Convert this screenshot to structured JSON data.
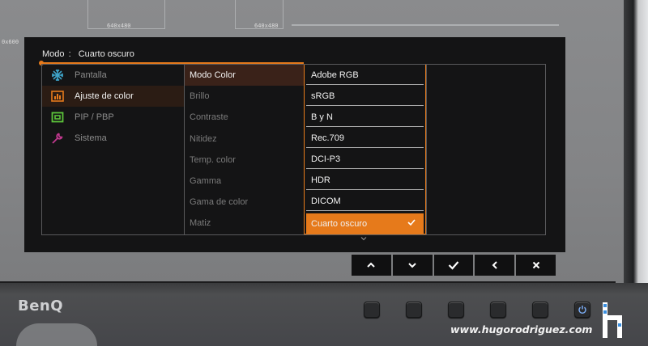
{
  "screen": {
    "guide_labels": [
      "640x480",
      "640x480",
      "0x600"
    ]
  },
  "osd": {
    "mode_label": "Modo",
    "mode_separator": ":",
    "mode_value": "Cuarto oscuro",
    "menu": [
      {
        "label": "Pantalla",
        "icon": "display-icon",
        "color": "#3ea3c8",
        "active": false
      },
      {
        "label": "Ajuste de color",
        "icon": "color-adjust-icon",
        "color": "#e67a1b",
        "active": true
      },
      {
        "label": "PIP / PBP",
        "icon": "pip-icon",
        "color": "#5cc33a",
        "active": false
      },
      {
        "label": "Sistema",
        "icon": "wrench-icon",
        "color": "#c0388e",
        "active": false
      }
    ],
    "submenu": [
      {
        "label": "Modo Color",
        "active": true
      },
      {
        "label": "Brillo",
        "active": false
      },
      {
        "label": "Contraste",
        "active": false
      },
      {
        "label": "Nitidez",
        "active": false
      },
      {
        "label": "Temp. color",
        "active": false
      },
      {
        "label": "Gamma",
        "active": false
      },
      {
        "label": "Gama de color",
        "active": false
      },
      {
        "label": "Matiz",
        "active": false
      }
    ],
    "options": [
      {
        "label": "Adobe RGB",
        "selected": false
      },
      {
        "label": "sRGB",
        "selected": false
      },
      {
        "label": "B y N",
        "selected": false
      },
      {
        "label": "Rec.709",
        "selected": false
      },
      {
        "label": "DCI-P3",
        "selected": false
      },
      {
        "label": "HDR",
        "selected": false
      },
      {
        "label": "DICOM",
        "selected": false
      },
      {
        "label": "Cuarto oscuro",
        "selected": true
      }
    ],
    "accent_color": "#e67a1b",
    "softkeys": [
      "chevron-up-icon",
      "chevron-down-icon",
      "check-icon",
      "chevron-left-icon",
      "close-icon"
    ]
  },
  "bezel": {
    "brand": "BenQ",
    "watermark": "www.hugorodriguez.com"
  }
}
